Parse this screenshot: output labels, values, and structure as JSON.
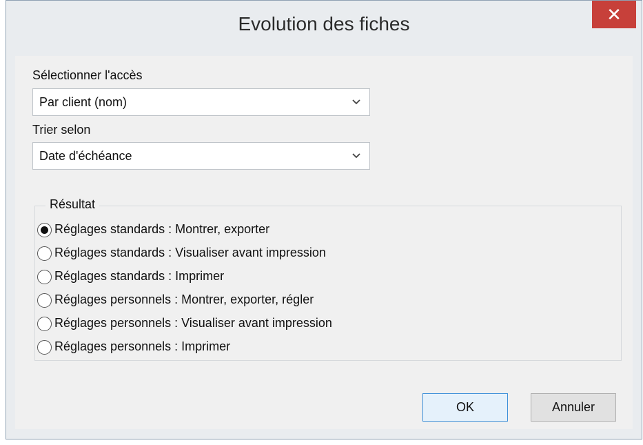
{
  "window": {
    "title": "Evolution des fiches",
    "close_label": "✕"
  },
  "access": {
    "label": "Sélectionner l'accès",
    "selected": "Par client (nom)"
  },
  "sort": {
    "label": "Trier selon",
    "selected": "Date d'échéance"
  },
  "result": {
    "title": "Résultat",
    "selected_index": 0,
    "options": [
      "Réglages standards : Montrer, exporter",
      "Réglages standards : Visualiser avant impression",
      "Réglages standards : Imprimer",
      "Réglages personnels : Montrer, exporter, régler",
      "Réglages personnels : Visualiser avant impression",
      "Réglages personnels : Imprimer"
    ]
  },
  "buttons": {
    "ok_label": "OK",
    "cancel_label": "Annuler"
  },
  "colors": {
    "close_button": "#c7403a",
    "ok_border": "#3c8fd9"
  },
  "icons": {
    "dropdown_arrow": "chevron-down-icon",
    "close": "close-icon"
  }
}
